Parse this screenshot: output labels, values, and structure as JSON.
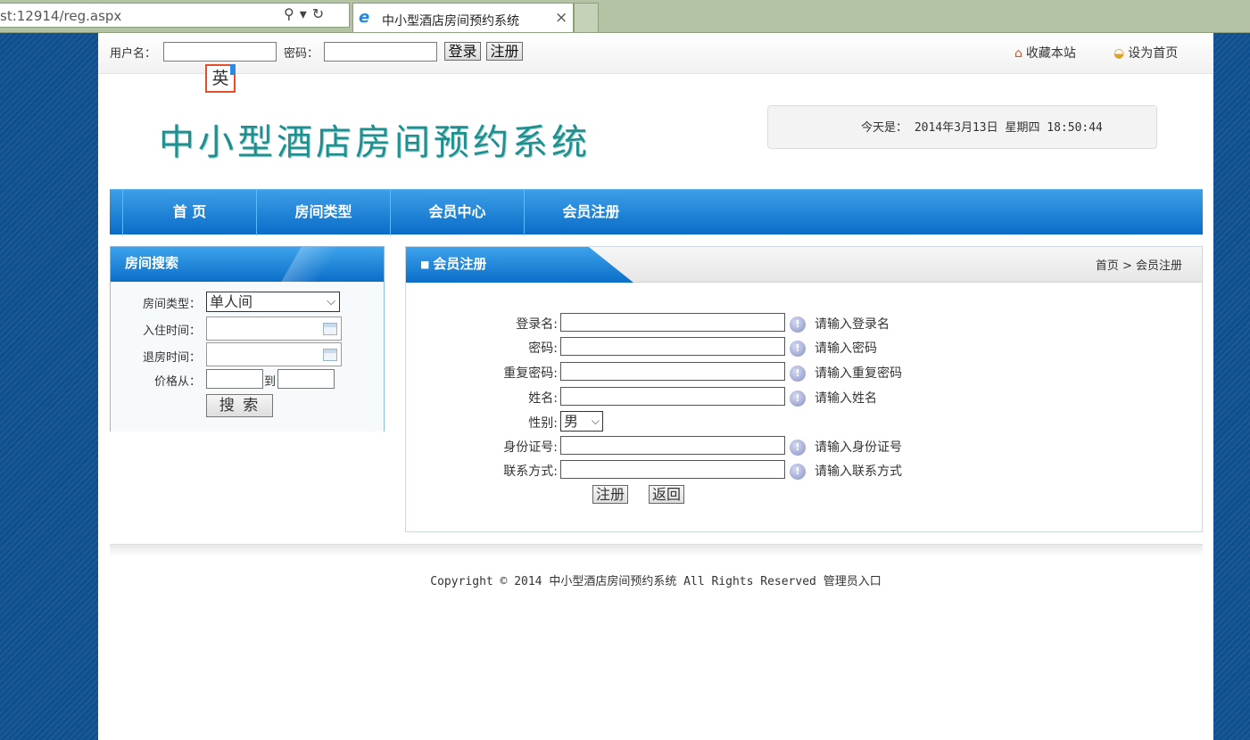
{
  "browser": {
    "address": "st:12914/reg.aspx",
    "tab_title": "中小型酒店房间预约系统",
    "search_icon": "search-icon",
    "refresh_icon": "refresh-icon",
    "close_glyph": "×"
  },
  "topbar": {
    "username_label": "用户名：",
    "password_label": "密码：",
    "login_button": "登录",
    "register_button": "注册",
    "bookmark_link": "收藏本站",
    "homepage_link": "设为首页",
    "ime_indicator": "英"
  },
  "header": {
    "logo_text": "中小型酒店房间预约系统",
    "date_text": "今天是： 2014年3月13日  星期四  18:50:44"
  },
  "nav": {
    "items": [
      "首 页",
      "房间类型",
      "会员中心",
      "会员注册"
    ]
  },
  "search_panel": {
    "title": "房间搜索",
    "room_type_label": "房间类型：",
    "room_type_value": "单人间",
    "checkin_label": "入住时间：",
    "checkout_label": "退房时间：",
    "price_from_label": "价格从：",
    "price_to_label": "到",
    "search_button": "搜 索"
  },
  "register_panel": {
    "title": "会员注册",
    "breadcrumb": "首页 > 会员注册",
    "fields": [
      {
        "label": "登录名:",
        "hint": "请输入登录名"
      },
      {
        "label": "密码:",
        "hint": "请输入密码"
      },
      {
        "label": "重复密码:",
        "hint": "请输入重复密码"
      },
      {
        "label": "姓名:",
        "hint": "请输入姓名"
      },
      {
        "label": "性别:",
        "value": "男"
      },
      {
        "label": "身份证号:",
        "hint": "请输入身份证号"
      },
      {
        "label": "联系方式:",
        "hint": "请输入联系方式"
      }
    ],
    "submit_button": "注册",
    "back_button": "返回"
  },
  "footer": {
    "copyright": "Copyright © 2014 中小型酒店房间预约系统 All Rights Reserved 管理员入口"
  },
  "colors": {
    "nav_blue": "#0a6cc7",
    "logo_teal": "#1f8f8f",
    "background_blue": "#0e4f8e"
  }
}
